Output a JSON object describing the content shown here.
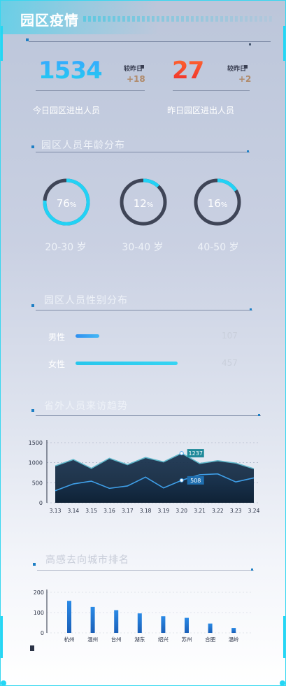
{
  "header": {
    "title": "园区疫情"
  },
  "stats": {
    "today": {
      "value": "1534",
      "label": "较昨日",
      "delta": "+18",
      "caption": "今日园区进出人员"
    },
    "yesterday": {
      "value": "27",
      "label": "较昨日",
      "delta": "+2",
      "caption": "昨日园区进出人员"
    }
  },
  "age": {
    "title": "园区人员年龄分布",
    "items": [
      {
        "pct": 76,
        "unit": "%",
        "label": "20-30 岁"
      },
      {
        "pct": 12,
        "unit": "%",
        "label": "30-40 岁"
      },
      {
        "pct": 16,
        "unit": "%",
        "label": "40-50 岁"
      }
    ]
  },
  "gender": {
    "title": "园区人员性别分布",
    "items": [
      {
        "label": "男性",
        "value": "107",
        "count": 107
      },
      {
        "label": "女性",
        "value": "457",
        "count": 457
      }
    ]
  },
  "trend": {
    "title": "省外人员来访趋势",
    "chart_data": {
      "type": "area",
      "categories": [
        "3.13",
        "3.14",
        "3.15",
        "3.16",
        "3.17",
        "3.18",
        "3.19",
        "3.20",
        "3.21",
        "3.22",
        "3.23",
        "3.24"
      ],
      "yticks": [
        "1500",
        "1000",
        "500",
        "0"
      ],
      "ylim": [
        0,
        1500
      ],
      "series": [
        {
          "values": [
            920,
            1080,
            860,
            1110,
            950,
            1130,
            1020,
            1237,
            980,
            1050,
            990,
            850
          ]
        },
        {
          "values": [
            300,
            470,
            540,
            360,
            420,
            640,
            370,
            560,
            700,
            720,
            520,
            620
          ]
        }
      ],
      "callouts": [
        "1237",
        "508"
      ]
    }
  },
  "cities": {
    "title": "高感去向城市排名",
    "chart_data": {
      "type": "bar",
      "categories": [
        "杭州",
        "温州",
        "台州",
        "湖东",
        "绍兴",
        "苏州",
        "合肥",
        "温岭"
      ],
      "yticks": [
        "200",
        "100",
        "0"
      ],
      "ylim": [
        0,
        200
      ],
      "values": [
        158,
        128,
        112,
        96,
        82,
        74,
        46,
        24
      ]
    }
  }
}
